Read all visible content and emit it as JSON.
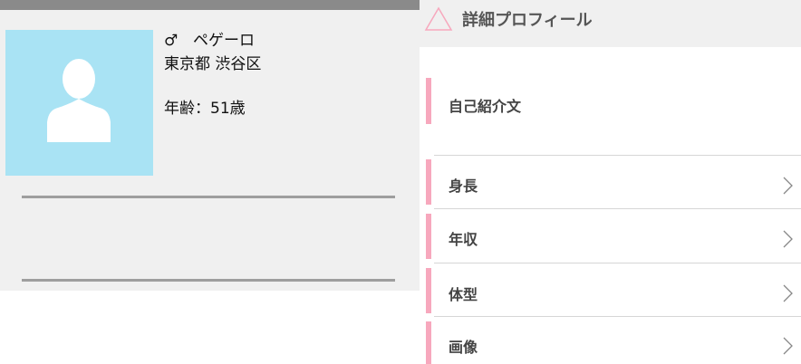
{
  "profile": {
    "gender_symbol": "♂",
    "name": "ペゲーロ",
    "location": "東京都 渋谷区",
    "age": "年齢：51歳"
  },
  "detail": {
    "title": "詳細プロフィール",
    "sections": [
      {
        "label": "自己紹介文"
      },
      {
        "label": "身長"
      },
      {
        "label": "年収"
      },
      {
        "label": "体型"
      },
      {
        "label": "画像"
      }
    ]
  },
  "colors": {
    "accent_pink": "#f7a8bd",
    "avatar_bg": "#a9e3f4"
  }
}
